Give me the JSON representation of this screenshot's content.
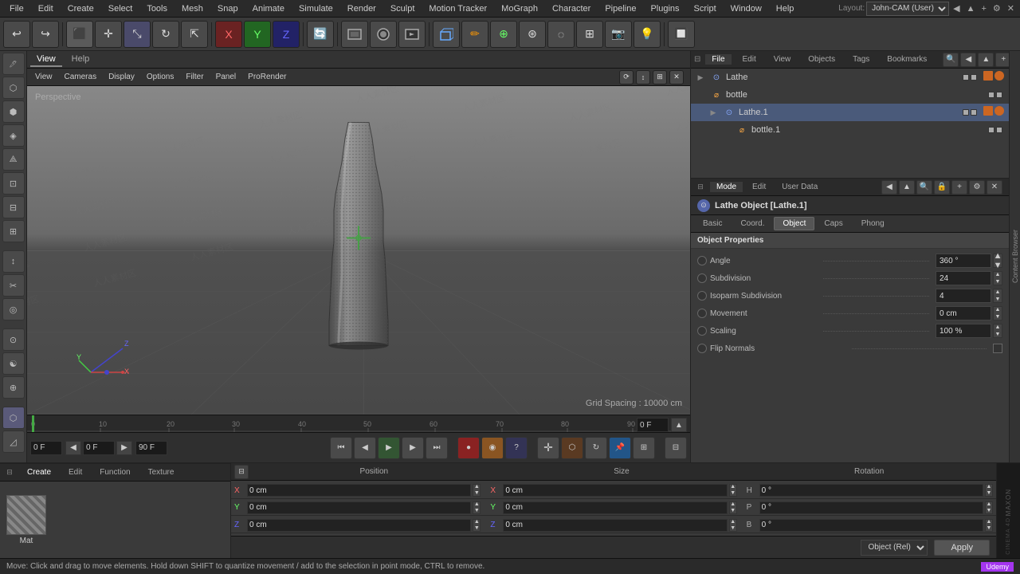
{
  "menu": {
    "items": [
      "File",
      "Edit",
      "Create",
      "Select",
      "Tools",
      "Mesh",
      "Snap",
      "Animate",
      "Simulate",
      "Render",
      "Sculpt",
      "Motion Tracker",
      "MoGraph",
      "Character",
      "Pipeline",
      "Plugins",
      "Script",
      "Window",
      "Help"
    ]
  },
  "layout": {
    "label": "Layout:",
    "value": "John-CAM (User)"
  },
  "viewport": {
    "label": "Perspective",
    "grid_spacing": "Grid Spacing : 10000 cm",
    "tabs": [
      "View",
      "Cameras",
      "Display",
      "Options",
      "Filter",
      "Panel",
      "ProRender"
    ],
    "view_tab": "View",
    "help_tab": "Help"
  },
  "scene": {
    "tabs": [
      "File",
      "Edit",
      "View",
      "Objects",
      "Tags",
      "Bookmarks"
    ],
    "objects": [
      {
        "name": "Lathe",
        "indent": 0,
        "icon": "⊙",
        "selected": false
      },
      {
        "name": "bottle",
        "indent": 0,
        "icon": "⌀",
        "selected": false
      },
      {
        "name": "Lathe.1",
        "indent": 1,
        "icon": "⊙",
        "selected": true
      },
      {
        "name": "bottle.1",
        "indent": 2,
        "icon": "⌀",
        "selected": false
      }
    ]
  },
  "attributes": {
    "mode_tabs": [
      "Mode",
      "Edit",
      "User Data"
    ],
    "title": "Lathe Object [Lathe.1]",
    "sub_tabs": [
      "Basic",
      "Coord.",
      "Object",
      "Caps",
      "Phong"
    ],
    "active_sub_tab": "Object",
    "obj_props_label": "Object Properties",
    "fields": [
      {
        "label": "Angle",
        "dots": true,
        "value": "360 °",
        "has_spinner": true
      },
      {
        "label": "Subdivision",
        "dots": true,
        "value": "24",
        "has_spinner": true
      },
      {
        "label": "Isoparm Subdivision",
        "dots": true,
        "value": "4",
        "has_spinner": true
      },
      {
        "label": "Movement",
        "dots": true,
        "value": "0 cm",
        "has_spinner": true
      },
      {
        "label": "Scaling",
        "dots": true,
        "value": "100 %",
        "has_spinner": true
      },
      {
        "label": "Flip Normals",
        "dots": true,
        "value": "",
        "has_checkbox": true
      }
    ]
  },
  "psr": {
    "col_headers": [
      "Position",
      "Size",
      "Rotation"
    ],
    "rows": [
      {
        "axis": "X",
        "pos": "0 cm",
        "size": "0 cm",
        "rot_label": "H",
        "rot": "0 °"
      },
      {
        "axis": "Y",
        "pos": "0 cm",
        "size": "0 cm",
        "rot_label": "P",
        "rot": "0 °"
      },
      {
        "axis": "Z",
        "pos": "0 cm",
        "size": "0 cm",
        "rot_label": "B",
        "rot": "0 °"
      }
    ],
    "mode": "Object (Rel)",
    "apply_label": "Apply"
  },
  "material": {
    "toolbar": [
      "Create",
      "Edit",
      "Function",
      "Texture"
    ],
    "name": "Mat"
  },
  "timeline": {
    "current_frame": "0 F",
    "start_frame": "0 F",
    "end_frame": "90 F",
    "max_frame": "90 F"
  },
  "status": {
    "text": "Move: Click and drag to move elements. Hold down SHIFT to quantize movement / add to the selection in point mode, CTRL to remove."
  },
  "icons": {
    "undo": "↩",
    "redo": "↪",
    "move": "✛",
    "scale": "⤡",
    "rotate": "↻",
    "select": "▣",
    "play": "▶",
    "pause": "⏸",
    "stop": "■",
    "record": "●",
    "rewind": "⏮",
    "ff": "⏭",
    "step_back": "◀",
    "step_fwd": "▶"
  }
}
